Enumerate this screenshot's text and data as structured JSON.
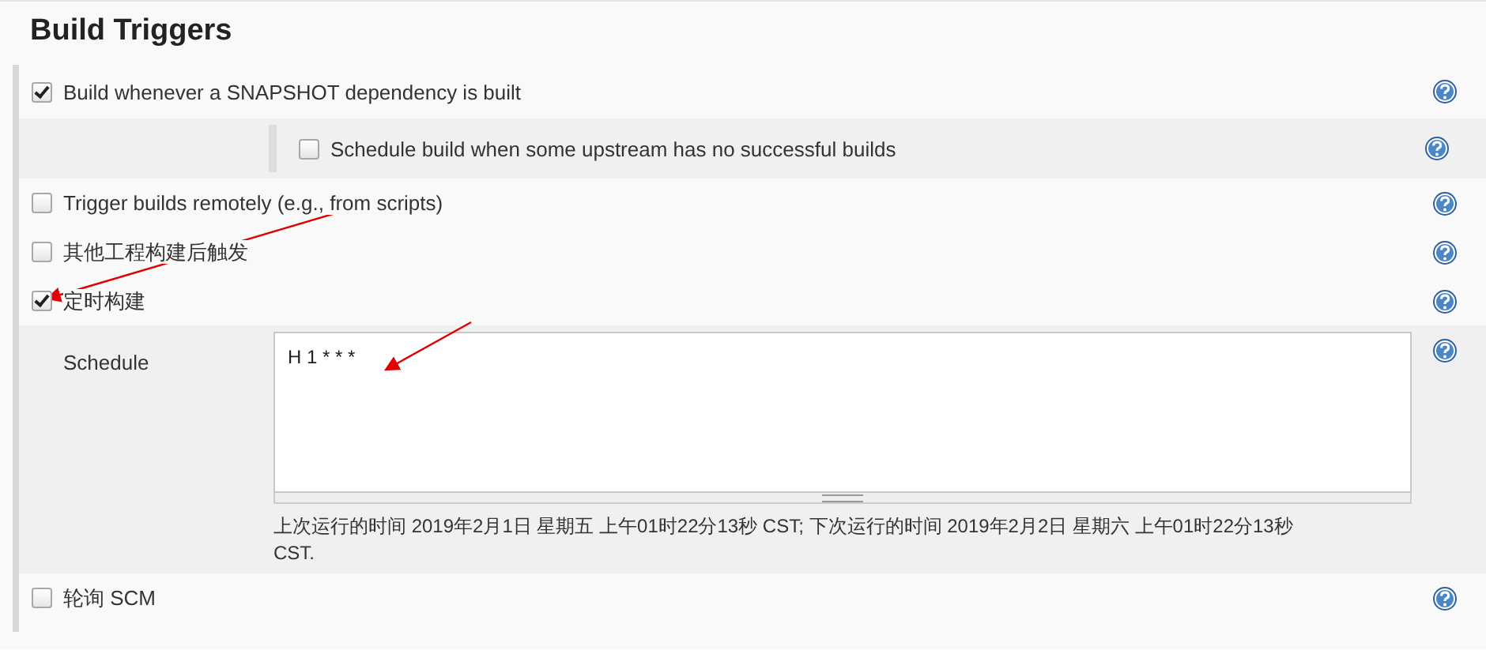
{
  "title": "Build Triggers",
  "triggers": [
    {
      "label": "Build whenever a SNAPSHOT dependency is built",
      "checked": true,
      "children": [
        {
          "label": "Schedule build when some upstream has no successful builds",
          "checked": false
        }
      ]
    },
    {
      "label": "Trigger builds remotely (e.g., from scripts)",
      "checked": false
    },
    {
      "label": "其他工程构建后触发",
      "checked": false
    },
    {
      "label": "定时构建",
      "checked": true,
      "schedule": {
        "label": "Schedule",
        "value": "H 1 * * *",
        "description": "上次运行的时间 2019年2月1日 星期五 上午01时22分13秒 CST; 下次运行的时间 2019年2月2日 星期六 上午01时22分13秒 CST."
      }
    },
    {
      "label": "轮询 SCM",
      "checked": false
    }
  ]
}
